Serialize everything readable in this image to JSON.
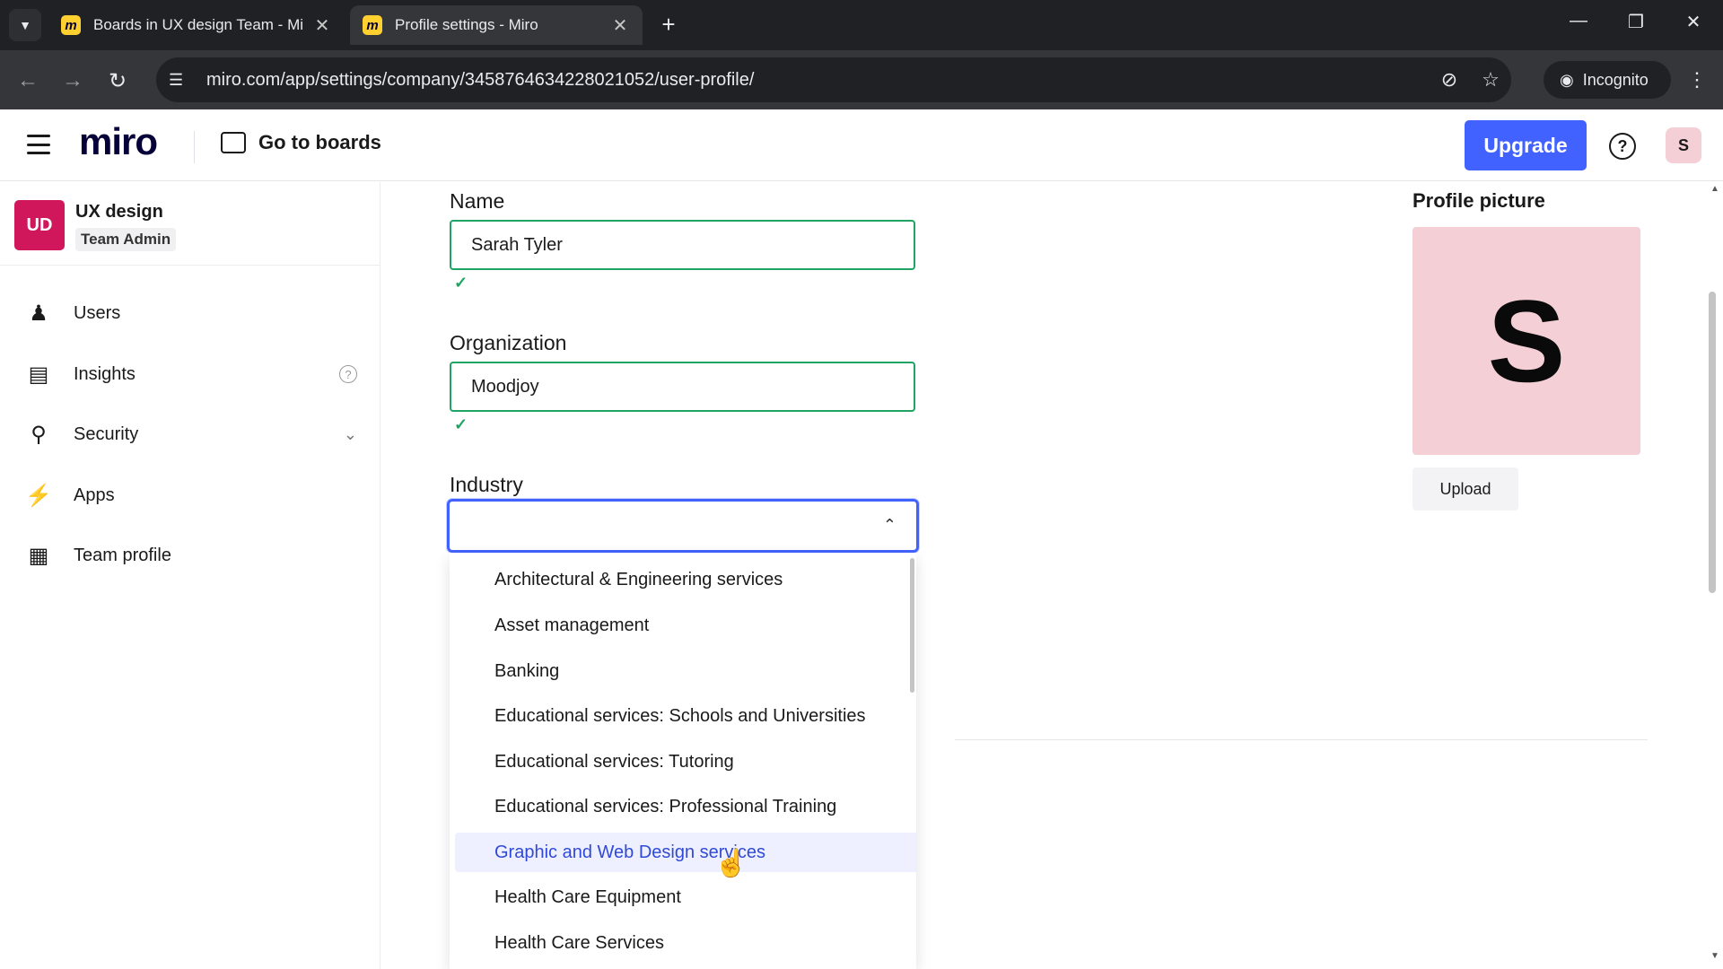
{
  "browser": {
    "tabs": [
      {
        "title": "Boards in UX design Team - Mi",
        "active": false
      },
      {
        "title": "Profile settings - Miro",
        "active": true
      }
    ],
    "url": "miro.com/app/settings/company/3458764634228021052/user-profile/",
    "incognito_label": "Incognito"
  },
  "header": {
    "logo": "miro",
    "go_to_boards": "Go to boards",
    "upgrade": "Upgrade",
    "help": "?",
    "avatar_initial": "S"
  },
  "sidebar": {
    "team_badge": "UD",
    "team_name": "UX design",
    "team_role": "Team Admin",
    "items": [
      {
        "label": "Users",
        "icon": "user-check-icon"
      },
      {
        "label": "Insights",
        "icon": "bar-chart-icon"
      },
      {
        "label": "Security",
        "icon": "key-icon"
      },
      {
        "label": "Apps",
        "icon": "plug-icon"
      },
      {
        "label": "Team profile",
        "icon": "layout-icon"
      }
    ]
  },
  "form": {
    "name_label": "Name",
    "name_value": "Sarah Tyler",
    "org_label": "Organization",
    "org_value": "Moodjoy",
    "industry_label": "Industry",
    "industry_value": "",
    "industry_options": [
      "Architectural & Engineering services",
      "Asset management",
      "Banking",
      "Educational services: Schools and Universities",
      "Educational services: Tutoring",
      "Educational services: Professional Training",
      "Graphic and Web Design services",
      "Health Care Equipment",
      "Health Care Services"
    ],
    "highlighted_option": "Graphic and Web Design services"
  },
  "profile_picture": {
    "label": "Profile picture",
    "initial": "S",
    "upload": "Upload",
    "bg_color": "#f4cfd6"
  },
  "colors": {
    "accent": "#4262ff",
    "valid": "#1fa463",
    "team_badge": "#d0175c"
  }
}
